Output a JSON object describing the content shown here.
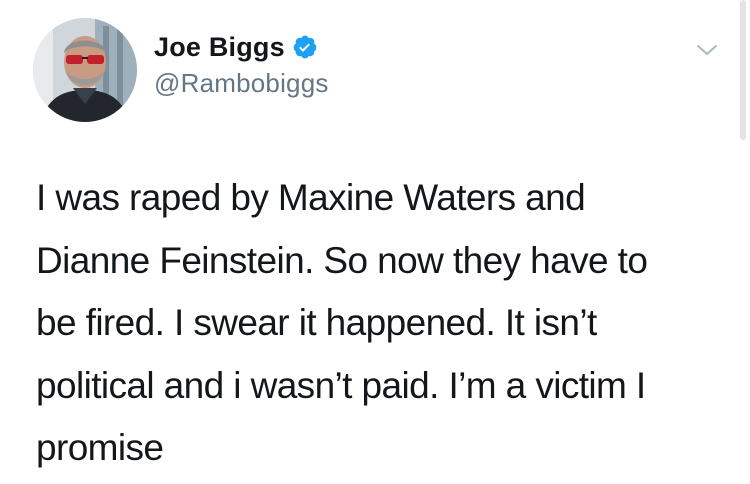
{
  "user": {
    "display_name": "Joe Biggs",
    "handle": "@Rambobiggs",
    "verified": true,
    "verified_color": "#1da1f2"
  },
  "tweet": {
    "lines": [
      "I was raped by Maxine Waters and",
      "Dianne Feinstein. So now they have to",
      "be fired. I swear it happened. It isn’t",
      "political and i wasn’t paid. I’m a victim I",
      "promise"
    ]
  },
  "icons": {
    "verified": "verified-badge-icon",
    "menu": "chevron-down-icon"
  },
  "colors": {
    "text": "#14171a",
    "secondary_text": "#657786",
    "background": "#ffffff"
  }
}
